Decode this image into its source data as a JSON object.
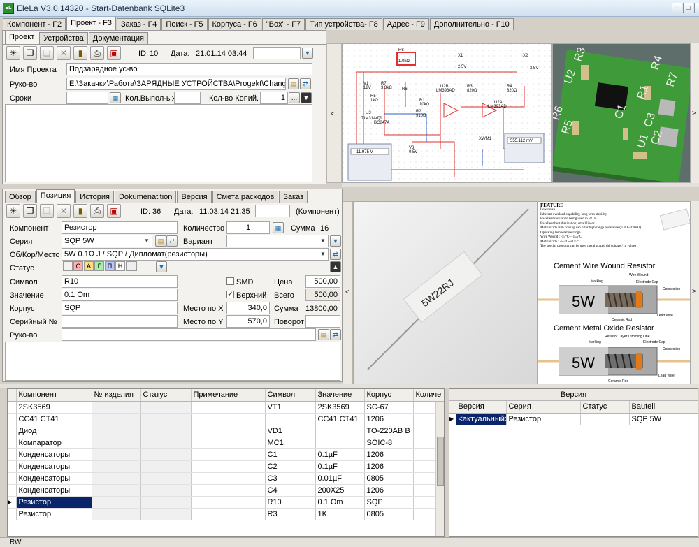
{
  "window": {
    "title": "EleLa V3.0.14320 - Start-Datenbank SQLite3",
    "icon": "app-icon"
  },
  "main_tabs": [
    "Компонент - F2",
    "Проект - F3",
    "Заказ - F4",
    "Поиск - F5",
    "Корпуса - F6",
    "\"Box\" - F7",
    "Тип устройства- F8",
    "Адрес - F9",
    "Дополнительно - F10"
  ],
  "project": {
    "tabs": [
      "Проект",
      "Устройства",
      "Документация"
    ],
    "id_label": "ID:",
    "id": "10",
    "date_label": "Дата:",
    "date": "21.01.14 03:44",
    "name_label": "Имя Проекта",
    "name": "Подзарядное ус-во",
    "path_label": "Руко-во",
    "path": "E:\\Закачки\\Работа\\ЗАРЯДНЫЕ УСТРОЙСТВА\\Progekt\\Changer on",
    "term_label": "Сроки",
    "done_label": "Кол.Выпол-ых",
    "copies_label": "Кол-во Копий.",
    "copies": "1"
  },
  "position": {
    "tabs": [
      "Обзор",
      "Позиция",
      "История",
      "Dokumenatition",
      "Версия",
      "Смета расходов",
      "Заказ"
    ],
    "id_label": "ID:",
    "id": "36",
    "date_label": "Дата:",
    "date": "11.03.14 21:35",
    "kind": "(Компонент)",
    "component_label": "Компонент",
    "component": "Резистор",
    "qty_label": "Количество",
    "qty": "1",
    "sum_label": "Сумма",
    "sum": "16",
    "series_label": "Серия",
    "series": "SQP 5W",
    "variant_label": "Вариант",
    "object_label": "Об/Кор/Место",
    "object": "5W 0.1Ω J / SQP / Дипломат(резисторы)",
    "status_label": "Статус",
    "status_buttons": [
      "О",
      "А",
      "Г",
      "П",
      "Н",
      "..."
    ],
    "symbol_label": "Символ",
    "symbol": "R10",
    "smd_label": "SMD",
    "price_label": "Цена",
    "price": "500,00",
    "value_label": "Значение",
    "value": "0.1 Om",
    "top_label": "Верхний",
    "total_label": "Всего",
    "total": "500,00",
    "case_label": "Корпус",
    "case": "SQP",
    "posx_label": "Место по X",
    "posx": "340,0",
    "sum2_label": "Сумма",
    "sum2": "13800,00",
    "serial_label": "Серийный №",
    "posy_label": "Место по Y",
    "posy": "570,0",
    "rotate_label": "Поворот",
    "guide_label": "Руко-во"
  },
  "schematic": {
    "labels": [
      "R8",
      "1.0kΩ",
      "X1",
      "X2",
      "V1",
      "12V",
      "R7",
      "3.3kΩ",
      "R6",
      "R5",
      "1kΩ",
      "R3",
      "820Ω",
      "R4",
      "820Ω",
      "R1",
      "10kΩ",
      "U2B",
      "LM393AD",
      "U2A",
      "LM393AD",
      "U3",
      "TL431ACD",
      "Q1",
      "BC847A",
      "V3",
      "0.5V",
      "R2",
      "910Ω",
      "2.5V",
      "2.5V",
      "XWM1"
    ],
    "meter_left": "11.975 V",
    "meter_right": "555.112 mV"
  },
  "pcb": {
    "labels": [
      "R3",
      "U2",
      "R1",
      "R4",
      "R7",
      "C1",
      "C3",
      "R5",
      "U1",
      "C2",
      "R6"
    ]
  },
  "datasheet": {
    "feature_title": "FEATURE",
    "features": [
      "Low noise",
      "Inherent overload capability, long term stability",
      "Excellent insulation being used in P.C.B.",
      "Excellent heat dissipation; small linear",
      "Metal oxide film coating can offer high range resistance (0.1Ω~100KΩ)",
      "Operating temperature range",
      "Wire Wound : -55°C~+155°C",
      "Metal oxide : -55°C~+155°C",
      "The special products can be used metal glazed (hi voltage / hi value)"
    ],
    "wire_title": "Cement Wire Wound Resistor",
    "oxide_title": "Cement Metal Oxide Resistor",
    "marking": "Marking",
    "wire_wound": "Wire Wound",
    "electrode": "Electrode Cap",
    "connection": "Connection",
    "lead_wire": "Lead Wire",
    "ceramic_rod": "Ceramic Rod",
    "resistor_layer": "Resistor Layer",
    "trimming_line": "Trimming Line",
    "watt": "5W"
  },
  "photo": {
    "marking": "5W22RJ"
  },
  "grid": {
    "columns": [
      "Компонент",
      "№ изделия",
      "Статус",
      "Примечание",
      "Символ",
      "Значение",
      "Корпус",
      "Количе"
    ],
    "rows": [
      {
        "component": "2SK3569",
        "symbol": "VT1",
        "value": "2SK3569",
        "case": "SC-67"
      },
      {
        "component": "CC41 CT41",
        "symbol": "",
        "value": "CC41 CT41",
        "case": "1206"
      },
      {
        "component": "Диод",
        "symbol": "VD1",
        "value": "",
        "case": "TO-220AB B"
      },
      {
        "component": "Компаратор",
        "symbol": "MC1",
        "value": "",
        "case": "SOIC-8"
      },
      {
        "component": "Конденсаторы",
        "symbol": "C1",
        "value": "0.1µF",
        "case": "1206"
      },
      {
        "component": "Конденсаторы",
        "symbol": "C2",
        "value": "0.1µF",
        "case": "1206"
      },
      {
        "component": "Конденсаторы",
        "symbol": "C3",
        "value": "0.01µF",
        "case": "0805"
      },
      {
        "component": "Конденсаторы",
        "symbol": "C4",
        "value": "200X25",
        "case": "1206"
      },
      {
        "component": "Резистор",
        "symbol": "R10",
        "value": "0.1 Om",
        "case": "SQP"
      },
      {
        "component": "Резистор",
        "symbol": "R3",
        "value": "1K",
        "case": "0805"
      }
    ]
  },
  "version": {
    "title": "Версия",
    "columns": [
      "Версия",
      "Серия",
      "Статус",
      "Bauteil"
    ],
    "row": {
      "version": "<актуальный>",
      "series": "Резистор",
      "status": "",
      "part": "SQP 5W"
    }
  },
  "statusbar": {
    "mode": "RW"
  },
  "colors": {
    "selection": "#0a246a",
    "pcb_green": "#3f9b3a",
    "schematic_red": "#e03030"
  }
}
